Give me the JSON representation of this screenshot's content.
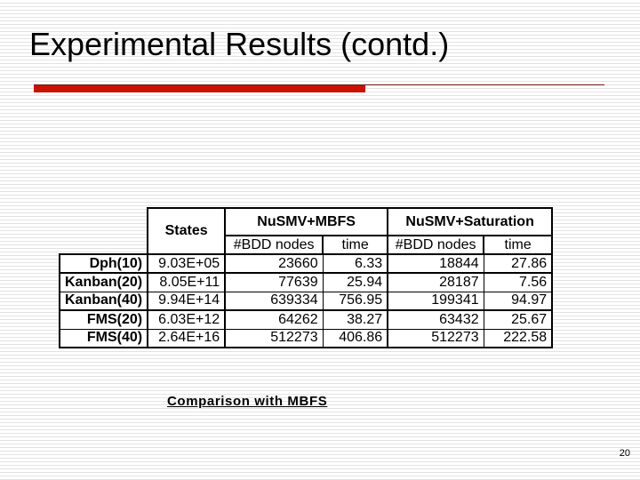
{
  "slide": {
    "title": "Experimental Results (contd.)",
    "caption": "Comparison with MBFS",
    "page_number": "20",
    "accent_red": "#cc1100",
    "rule_dark_red": "#6b1414"
  },
  "table": {
    "corner_label": "",
    "header_groups": [
      {
        "label": "States",
        "span": 1,
        "rowspan": 2
      },
      {
        "label": "NuSMV+MBFS",
        "span": 2,
        "rowspan": 1
      },
      {
        "label": "NuSMV+Saturation",
        "span": 2,
        "rowspan": 1
      }
    ],
    "header_sub": [
      "#BDD nodes",
      "time",
      "#BDD nodes",
      "time"
    ],
    "columns": [
      "model",
      "States",
      "mbfs_bdd_nodes",
      "mbfs_time",
      "sat_bdd_nodes",
      "sat_time"
    ],
    "rows": [
      {
        "model": "Dph(10)",
        "states": "9.03E+05",
        "mbfs_bdd_nodes": "23660",
        "mbfs_time": "6.33",
        "sat_bdd_nodes": "18844",
        "sat_time": "27.86"
      },
      {
        "model": "Kanban(20)",
        "states": "8.05E+11",
        "mbfs_bdd_nodes": "77639",
        "mbfs_time": "25.94",
        "sat_bdd_nodes": "28187",
        "sat_time": "7.56"
      },
      {
        "model": "Kanban(40)",
        "states": "9.94E+14",
        "mbfs_bdd_nodes": "639334",
        "mbfs_time": "756.95",
        "sat_bdd_nodes": "199341",
        "sat_time": "94.97"
      },
      {
        "model": "FMS(20)",
        "states": "6.03E+12",
        "mbfs_bdd_nodes": "64262",
        "mbfs_time": "38.27",
        "sat_bdd_nodes": "63432",
        "sat_time": "25.67"
      },
      {
        "model": "FMS(40)",
        "states": "2.64E+16",
        "mbfs_bdd_nodes": "512273",
        "mbfs_time": "406.86",
        "sat_bdd_nodes": "512273",
        "sat_time": "222.58"
      }
    ]
  }
}
